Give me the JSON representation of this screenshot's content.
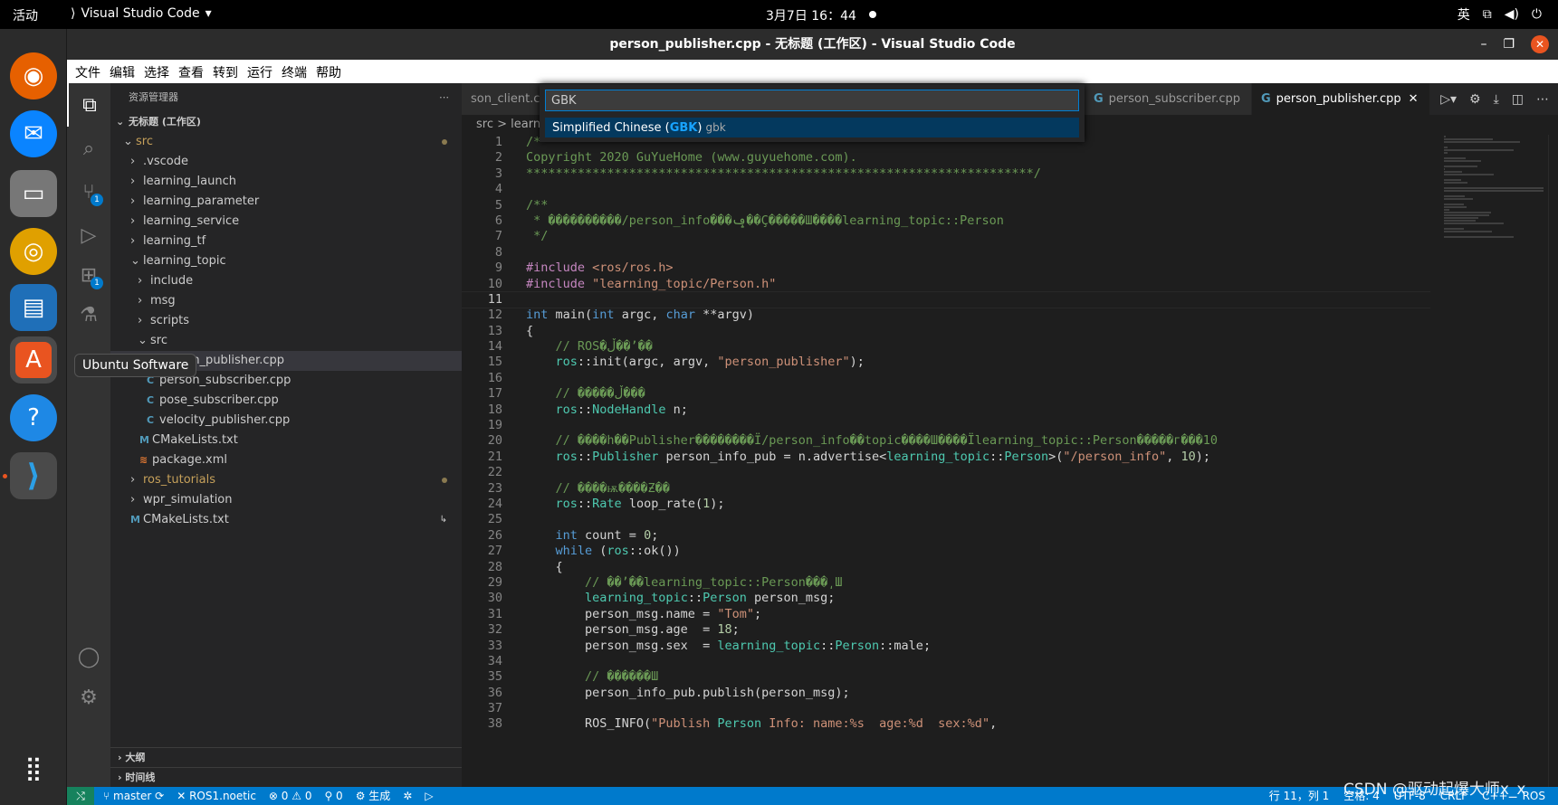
{
  "topbar": {
    "activities": "活动",
    "app_name": "Visual Studio Code",
    "clock": "3月7日  16：44",
    "input_method": "英"
  },
  "dock": {
    "tooltip": "Ubuntu Software"
  },
  "window": {
    "title": "person_publisher.cpp - 无标题 (工作区) - Visual Studio Code"
  },
  "menu": [
    "文件",
    "编辑",
    "选择",
    "查看",
    "转到",
    "运行",
    "终端",
    "帮助"
  ],
  "activity_badges": {
    "scm": "1",
    "extensions": "1"
  },
  "explorer": {
    "header": "资源管理器",
    "workspace": "无标题 (工作区)",
    "items": [
      {
        "label": "src",
        "kind": "folder-open"
      },
      {
        "label": ".vscode",
        "kind": "folder"
      },
      {
        "label": "learning_launch",
        "kind": "folder"
      },
      {
        "label": "learning_parameter",
        "kind": "folder"
      },
      {
        "label": "learning_service",
        "kind": "folder"
      },
      {
        "label": "learning_tf",
        "kind": "folder"
      },
      {
        "label": "learning_topic",
        "kind": "folder-open"
      },
      {
        "label": "include",
        "kind": "folder"
      },
      {
        "label": "msg",
        "kind": "folder"
      },
      {
        "label": "scripts",
        "kind": "folder"
      },
      {
        "label": "src",
        "kind": "folder-open"
      },
      {
        "label": "person_publisher.cpp",
        "kind": "cpp"
      },
      {
        "label": "person_subscriber.cpp",
        "kind": "cpp"
      },
      {
        "label": "pose_subscriber.cpp",
        "kind": "cpp"
      },
      {
        "label": "velocity_publisher.cpp",
        "kind": "cpp"
      },
      {
        "label": "CMakeLists.txt",
        "kind": "cmake"
      },
      {
        "label": "package.xml",
        "kind": "xml"
      },
      {
        "label": "ros_tutorials",
        "kind": "folder"
      },
      {
        "label": "wpr_simulation",
        "kind": "folder"
      },
      {
        "label": "CMakeLists.txt",
        "kind": "cmake"
      }
    ],
    "outline": "大纲",
    "timeline": "时间线"
  },
  "tabs": {
    "tab1": "son_client.cpp",
    "tab2": "person_subscriber.cpp",
    "tab3": "person_publisher.cpp"
  },
  "breadcrumbs": "src  >  learnin",
  "palette": {
    "input_value": "GBK",
    "option_prefix": "Simplified Chinese (",
    "option_match": "GBK",
    "option_suffix": ")",
    "option_desc": "gbk"
  },
  "code_lines": [
    "/*",
    "Copyright 2020 GuYueHome (www.guyuehome.com).",
    "*********************************************************************/",
    "",
    "/**",
    " * ����������/person_info���ݡ��Ҫ�����Ш����learning_topic::Person",
    " */",
    "",
    "#include <ros/ros.h>",
    "#include \"learning_topic/Person.h\"",
    "",
    "int main(int argc, char **argv)",
    "{",
    "    // ROS�ڵ��ʼ��",
    "    ros::init(argc, argv, \"person_publisher\");",
    "",
    "    // �����ڵ���",
    "    ros::NodeHandle n;",
    "",
    "    // ����һ��Publisher��������Ϊ/person_info��topic����Ш����Ïlearning_topic::Person�����г���10",
    "    ros::Publisher person_info_pub = n.advertise<learning_topic::Person>(\"/person_info\", 10);",
    "",
    "    // ����ѭ����Ƶ��",
    "    ros::Rate loop_rate(1);",
    "",
    "    int count = 0;",
    "    while (ros::ok())",
    "    {",
    "        // ��ʼ��learning_topic::Person���͵Ш",
    "        learning_topic::Person person_msg;",
    "        person_msg.name = \"Tom\";",
    "        person_msg.age  = 18;",
    "        person_msg.sex  = learning_topic::Person::male;",
    "",
    "        // ������Ш",
    "        person_info_pub.publish(person_msg);",
    "",
    "        ROS_INFO(\"Publish Person Info: name:%s  age:%d  sex:%d\","
  ],
  "current_line": 11,
  "status": {
    "branch": "master",
    "ros": "ROS1.noetic",
    "problems": "⊗ 0 ⚠ 0",
    "ports": "⚲ 0",
    "build": "⚙ 生成",
    "position": "行 11，列 1",
    "spaces": "空格: 4",
    "encoding": "UTF-8",
    "eol": "CRLF",
    "language": "C++",
    "ros_right": "ROS"
  },
  "watermark": "CSDN @驱动起爆大师x_x"
}
